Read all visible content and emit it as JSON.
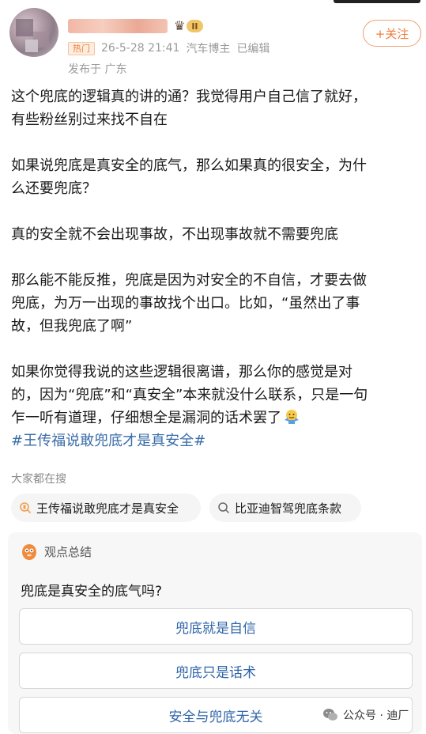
{
  "header": {
    "avatar": "blurred-avatar",
    "username_obscured": true,
    "level": "II",
    "follow_label": "+关注"
  },
  "meta": {
    "hot_tag": "热门",
    "datetime": "26-5-28 21:41",
    "role": "汽车博主",
    "edited": "已编辑",
    "location": "发布于 广东"
  },
  "post": {
    "paragraphs": [
      [
        "这个兜底的逻辑真的讲的通？我觉得用户自己信了就好，",
        "有些粉丝别过来找不自在"
      ],
      [
        "如果说兜底是真安全的底气，那么如果真的很安全，为什",
        "么还要兜底？"
      ],
      [
        "真的安全就不会出现事故，不出现事故就不需要兜底"
      ],
      [
        "那么能不能反推，兜底是因为对安全的不自信，才要去做",
        "兜底，为万一出现的事故找个出口。比如，“虽然出了事",
        "故，但我兜底了啊”"
      ],
      [
        "如果你觉得我说的这些逻辑很离谱，那么你的感觉是对",
        "的，因为“兜底”和“真安全”本来就没什么联系，只是一句",
        "乍一听有道理，仔细想全是漏洞的话术罢了"
      ]
    ],
    "emoji": "shrug-emoji",
    "hashtag": "#王传福说敢兜底才是真安全#"
  },
  "search": {
    "title": "大家都在搜",
    "chips": [
      {
        "label": "王传福说敢兜底才是真安全",
        "icon": "hot-search-icon"
      },
      {
        "label": "比亚迪智驾兜底条款",
        "icon": "search-icon"
      }
    ]
  },
  "summary": {
    "title": "观点总结",
    "question": "兜底是真安全的底气吗?",
    "options": [
      "兜底就是自信",
      "兜底只是话术",
      "安全与兜底无关"
    ]
  },
  "watermark": {
    "text": "公众号 · 迪厂",
    "icon": "wechat-icon"
  },
  "colors": {
    "accent_orange": "#f07b34",
    "hashtag_blue": "#3a6ca8",
    "option_blue": "#2f65a8"
  }
}
